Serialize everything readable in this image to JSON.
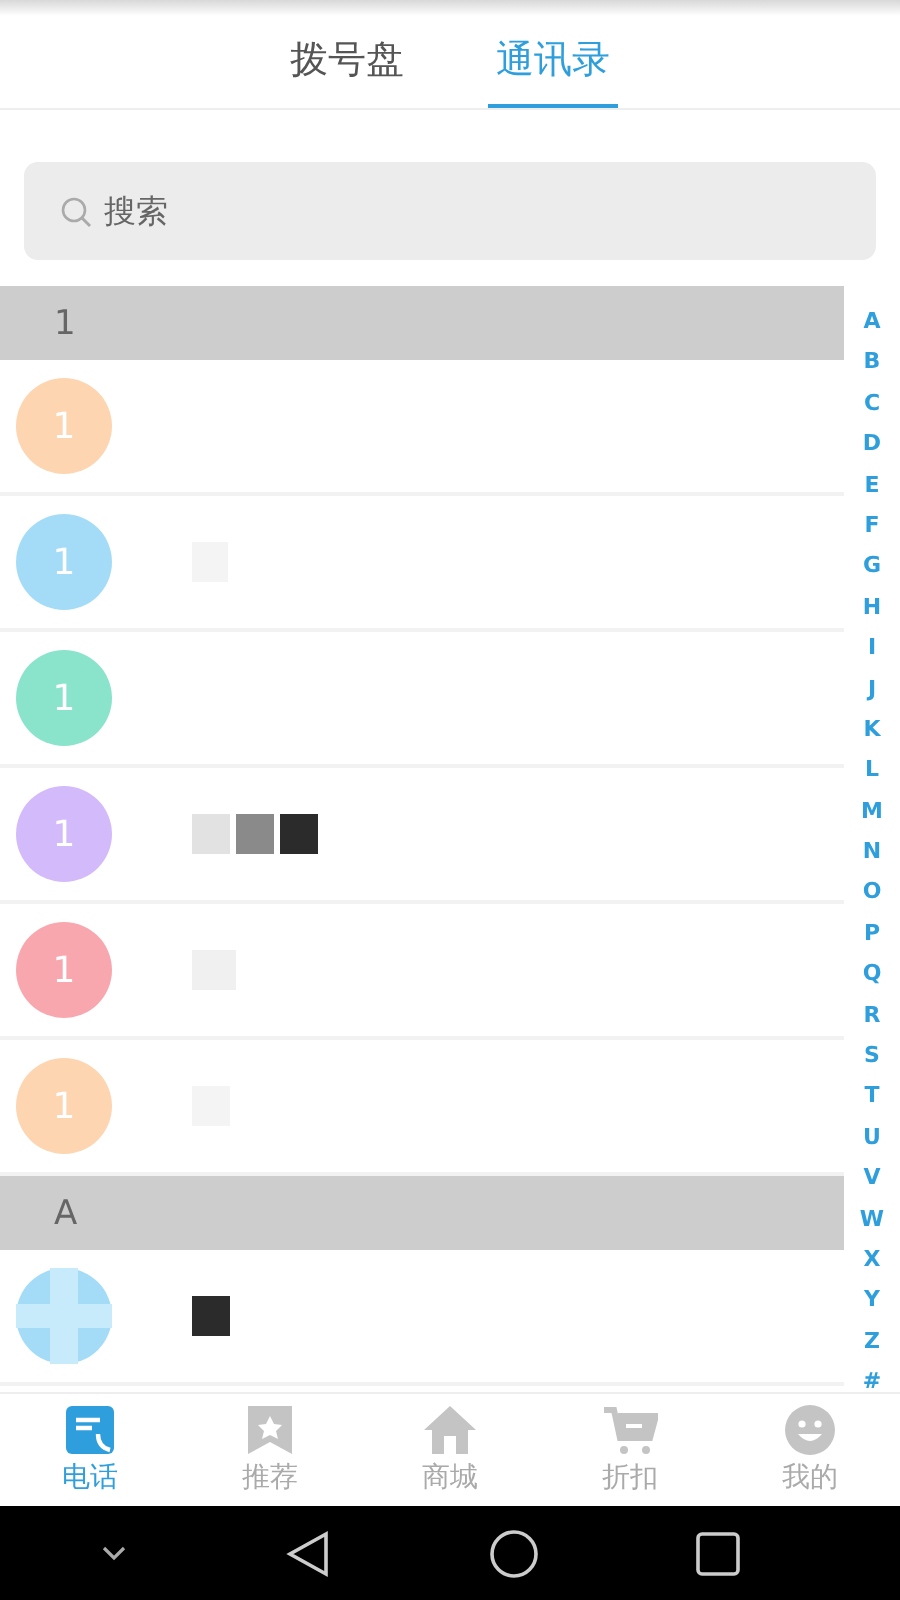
{
  "top_tabs": [
    {
      "label": "拨号盘",
      "selected": false
    },
    {
      "label": "通讯录",
      "selected": true
    }
  ],
  "search": {
    "placeholder": "搜索"
  },
  "sections": [
    {
      "header": "1",
      "contacts": [
        {
          "kind": "initial",
          "avatar": "1",
          "color": "#fdd5b1"
        },
        {
          "kind": "initial",
          "avatar": "1",
          "color": "#a4dcf8"
        },
        {
          "kind": "initial",
          "avatar": "1",
          "color": "#8ae3cb"
        },
        {
          "kind": "initial",
          "avatar": "1",
          "color": "#d2bafb"
        },
        {
          "kind": "initial",
          "avatar": "1",
          "color": "#f9a7af"
        },
        {
          "kind": "initial",
          "avatar": "1",
          "color": "#fdd5b1"
        }
      ]
    },
    {
      "header": "A"
    }
  ],
  "index": [
    "A",
    "B",
    "C",
    "D",
    "E",
    "F",
    "G",
    "H",
    "I",
    "J",
    "K",
    "L",
    "M",
    "N",
    "O",
    "P",
    "Q",
    "R",
    "S",
    "T",
    "U",
    "V",
    "W",
    "X",
    "Y",
    "Z",
    "#"
  ],
  "bottom_tabs": [
    {
      "label": "电话",
      "selected": true
    },
    {
      "label": "推荐",
      "selected": false
    },
    {
      "label": "商城",
      "selected": false
    },
    {
      "label": "折扣",
      "selected": false
    },
    {
      "label": "我的",
      "selected": false
    }
  ]
}
